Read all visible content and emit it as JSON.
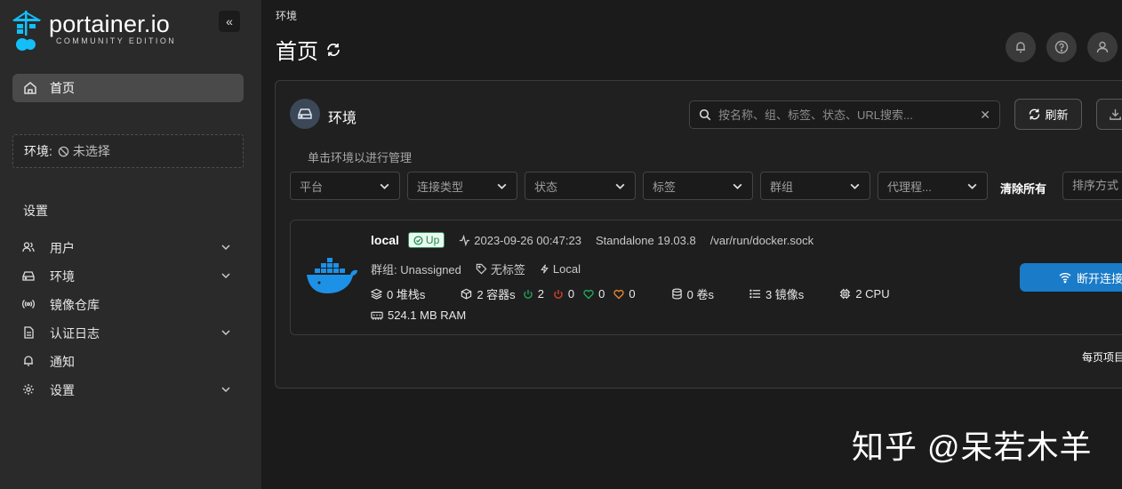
{
  "brand": {
    "name": "portainer.io",
    "edition": "COMMUNITY EDITION"
  },
  "sidebar": {
    "collapse_glyph": "«",
    "home_label": "首页",
    "env_selector": {
      "label": "环境:",
      "value": "未选择"
    },
    "section_title": "设置",
    "items": [
      {
        "label": "用户",
        "icon": "users-icon",
        "expandable": true
      },
      {
        "label": "环境",
        "icon": "drive-icon",
        "expandable": true
      },
      {
        "label": "镜像仓库",
        "icon": "broadcast-icon",
        "expandable": false
      },
      {
        "label": "认证日志",
        "icon": "document-icon",
        "expandable": true
      },
      {
        "label": "通知",
        "icon": "bell-icon",
        "expandable": false
      },
      {
        "label": "设置",
        "icon": "gear-icon",
        "expandable": true
      }
    ]
  },
  "header": {
    "breadcrumb": "环境",
    "title": "首页"
  },
  "environments": {
    "title": "环境",
    "search_placeholder": "按名称、组、标签、状态、URL搜索...",
    "refresh_label": "刷新",
    "hint": "单击环境以进行管理",
    "filters": [
      "平台",
      "连接类型",
      "状态",
      "标签",
      "群组",
      "代理程..."
    ],
    "clear_all": "清除所有",
    "sort_label": "排序方式",
    "per_page": "每页项目",
    "item": {
      "name": "local",
      "status": "Up",
      "timestamp": "2023-09-26 00:47:23",
      "type": "Standalone 19.03.8",
      "url": "/var/run/docker.sock",
      "group": "群组: Unassigned",
      "tags": "无标签",
      "location": "Local",
      "stacks": "0 堆栈s",
      "containers": "2 容器s",
      "running": "2",
      "stopped": "0",
      "healthy": "0",
      "unhealthy": "0",
      "volumes": "0 卷s",
      "images": "3 镜像s",
      "cpu": "2 CPU",
      "ram": "524.1 MB RAM",
      "disconnect_label": "断开连接"
    }
  },
  "watermark": "知乎 @呆若木羊",
  "colors": {
    "primary": "#1a7bc9",
    "up_green": "#1e8a4d",
    "running": "#22a559",
    "stopped": "#d9412f",
    "unhealthy": "#e0862e"
  }
}
